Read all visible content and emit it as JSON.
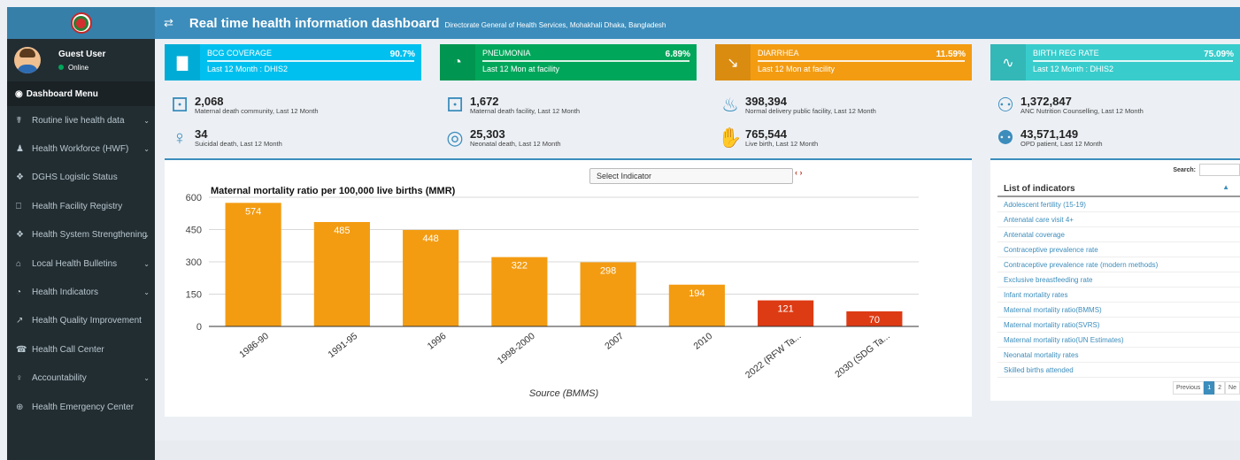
{
  "header": {
    "title": "Real time health information dashboard",
    "subtitle": "Directorate General of Health Services, Mohakhali Dhaka, Bangladesh",
    "color": "#3c8dbc"
  },
  "user": {
    "name": "Guest User",
    "status": "Online"
  },
  "sidebar": {
    "header_label": "Dashboard Menu",
    "items": [
      {
        "label": "Routine live health data",
        "icon": "stethoscope-icon",
        "has_submenu": true
      },
      {
        "label": "Health Workforce (HWF)",
        "icon": "users-icon",
        "has_submenu": true
      },
      {
        "label": "DGHS Logistic Status",
        "icon": "cubes-icon",
        "has_submenu": false
      },
      {
        "label": "Health Facility Registry",
        "icon": "hospital-icon",
        "has_submenu": false
      },
      {
        "label": "Health System Strengthening",
        "icon": "cubes-icon",
        "has_submenu": true
      },
      {
        "label": "Local Health Bulletins",
        "icon": "folder-icon",
        "has_submenu": true
      },
      {
        "label": "Health Indicators",
        "icon": "pie-icon",
        "has_submenu": true
      },
      {
        "label": "Health Quality Improvement",
        "icon": "line-chart-icon",
        "has_submenu": false
      },
      {
        "label": "Health Call Center",
        "icon": "phone-icon",
        "has_submenu": false
      },
      {
        "label": "Accountability",
        "icon": "user-key-icon",
        "has_submenu": true
      },
      {
        "label": "Health Emergency Center",
        "icon": "globe-icon",
        "has_submenu": false
      }
    ]
  },
  "stats": [
    {
      "label": "BCG COVERAGE",
      "value": "90.7%",
      "desc": "Last 12 Month : DHIS2",
      "color": "#00c0ef",
      "icon": "bar-chart-icon"
    },
    {
      "label": "PNEUMONIA",
      "value": "6.89%",
      "desc": "Last 12 Mon at facility",
      "color": "#00a65a",
      "icon": "pie-chart-icon"
    },
    {
      "label": "DIARRHEA",
      "value": "11.59%",
      "desc": "Last 12 Mon at facility",
      "color": "#f39c12",
      "icon": "trend-down-icon"
    },
    {
      "label": "BIRTH REG RATE",
      "value": "75.09%",
      "desc": "Last 12 Month : DHIS2",
      "color": "#39cccc",
      "icon": "heartbeat-icon"
    }
  ],
  "metrics": [
    {
      "value": "2,068",
      "label": "Maternal death community, Last 12 Month",
      "icon": "bed-icon"
    },
    {
      "value": "1,672",
      "label": "Maternal death facility, Last 12 Month",
      "icon": "bed-icon"
    },
    {
      "value": "398,394",
      "label": "Normal delivery public facility, Last 12 Month",
      "icon": "delivery-icon"
    },
    {
      "value": "1,372,847",
      "label": "ANC Nutrition Counselling, Last 12 Month",
      "icon": "counselling-icon"
    },
    {
      "value": "34",
      "label": "Suicidal death, Last 12 Month",
      "icon": "noose-icon"
    },
    {
      "value": "25,303",
      "label": "Neonatal death, Last 12 Month",
      "icon": "neonatal-icon"
    },
    {
      "value": "765,544",
      "label": "Live birth, Last 12 Month",
      "icon": "baby-hands-icon"
    },
    {
      "value": "43,571,149",
      "label": "OPD patient, Last 12 Month",
      "icon": "patients-icon"
    }
  ],
  "chart_panel": {
    "select_label": "Select Indicator",
    "nav": "‹ ›"
  },
  "chart_data": {
    "type": "bar",
    "title": "Maternal mortality ratio per 100,000 live births (MMR)",
    "xlabel": "Source (BMMS)",
    "ylabel": "",
    "ylim": [
      0,
      600
    ],
    "yticks": [
      0,
      150,
      300,
      450,
      600
    ],
    "categories": [
      "1986-90",
      "1991-95",
      "1996",
      "1998-2000",
      "2007",
      "2010",
      "2022 (RFW Ta...",
      "2030 (SDG Ta..."
    ],
    "values": [
      574,
      485,
      448,
      322,
      298,
      194,
      121,
      70
    ],
    "colors": [
      "#f39c12",
      "#f39c12",
      "#f39c12",
      "#f39c12",
      "#f39c12",
      "#f39c12",
      "#dd3b14",
      "#dd3b14"
    ],
    "grid": true,
    "legend": "none"
  },
  "indicators": {
    "search_label": "Search:",
    "header": "List of indicators",
    "items": [
      "Adolescent fertility (15-19)",
      "Antenatal care visit 4+",
      "Antenatal coverage",
      "Contraceptive prevalence rate",
      "Contraceptive prevalence rate (modern methods)",
      "Exclusive breastfeeding rate",
      "Infant mortality rates",
      "Maternal mortality ratio(BMMS)",
      "Maternal mortality ratio(SVRS)",
      "Maternal mortality ratio(UN Estimates)",
      "Neonatal mortality rates",
      "Skilled births attended"
    ],
    "pager": {
      "prev": "Previous",
      "pages": [
        "1",
        "2"
      ],
      "next": "Ne"
    }
  }
}
